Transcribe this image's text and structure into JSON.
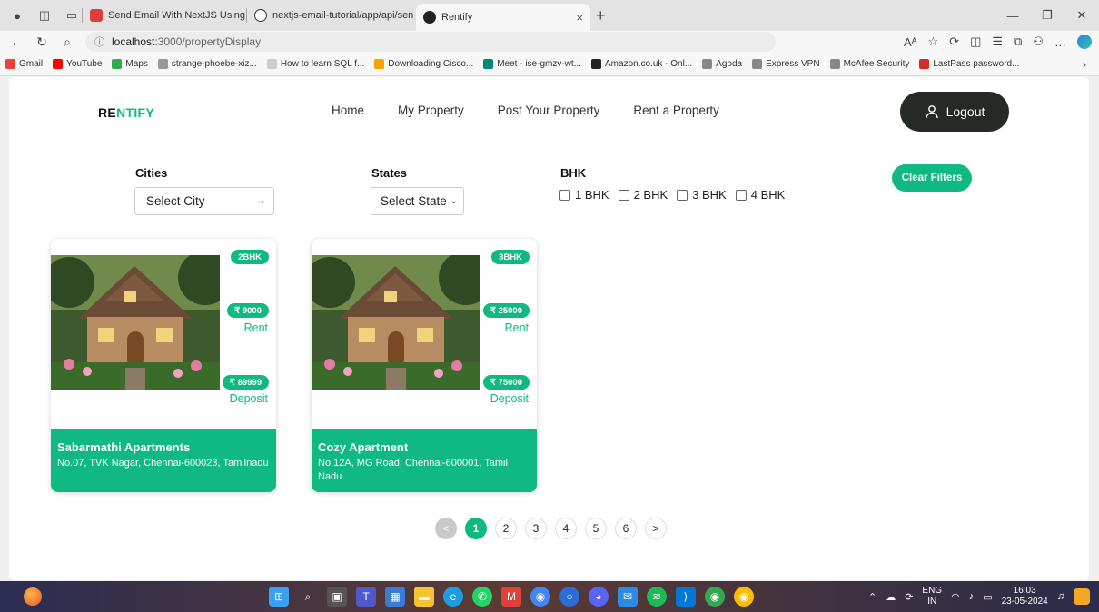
{
  "browser": {
    "tabs": [
      {
        "title": "Send Email With NextJS Using G",
        "color": "#e23b3b"
      },
      {
        "title": "nextjs-email-tutorial/app/api/sen",
        "color": "#333333"
      },
      {
        "title": "Rentify",
        "color": "#222222"
      }
    ],
    "url_host": "localhost",
    "url_path": ":3000/propertyDisplay",
    "bookmarks": [
      {
        "label": "Gmail",
        "color": "#ea4335"
      },
      {
        "label": "YouTube",
        "color": "#ff0000"
      },
      {
        "label": "Maps",
        "color": "#34a853"
      },
      {
        "label": "strange-phoebe-xiz...",
        "color": "#999999"
      },
      {
        "label": "How to learn SQL f...",
        "color": "#cccccc"
      },
      {
        "label": "Downloading Cisco...",
        "color": "#f4a300"
      },
      {
        "label": "Meet - ise-gmzv-wt...",
        "color": "#00897b"
      },
      {
        "label": "Amazon.co.uk - Onl...",
        "color": "#222222"
      },
      {
        "label": "Agoda",
        "color": "#888888"
      },
      {
        "label": "Express VPN",
        "color": "#888888"
      },
      {
        "label": "McAfee Security",
        "color": "#888888"
      },
      {
        "label": "LastPass password...",
        "color": "#d32d27"
      }
    ]
  },
  "header": {
    "logo_part1": "RE",
    "logo_part2": "NTIFY",
    "nav": [
      "Home",
      "My Property",
      "Post Your Property",
      "Rent a Property"
    ],
    "logout_label": "Logout"
  },
  "filters": {
    "cities_label": "Cities",
    "city_selected": "Select City",
    "states_label": "States",
    "state_selected": "Select State",
    "bhk_label": "BHK",
    "bhk_options": [
      "1 BHK",
      "2 BHK",
      "3 BHK",
      "4 BHK"
    ],
    "clear_label": "Clear Filters"
  },
  "properties": [
    {
      "bhk": "2BHK",
      "rent": "₹ 9000",
      "rent_label": "Rent",
      "deposit": "₹ 89999",
      "deposit_label": "Deposit",
      "name": "Sabarmathi Apartments",
      "address": "No.07, TVK Nagar, Chennai-600023, Tamilnadu"
    },
    {
      "bhk": "3BHK",
      "rent": "₹ 25000",
      "rent_label": "Rent",
      "deposit": "₹ 75000",
      "deposit_label": "Deposit",
      "name": "Cozy Apartment",
      "address": "No.12A, MG Road, Chennai-600001, Tamil Nadu"
    }
  ],
  "pagination": {
    "prev": "<",
    "pages": [
      "1",
      "2",
      "3",
      "4",
      "5",
      "6"
    ],
    "current": "1",
    "next": ">"
  },
  "taskbar": {
    "lang_top": "ENG",
    "lang_bottom": "IN",
    "time": "16:03",
    "date": "23-05-2024"
  },
  "theme": {
    "accent": "#10b981",
    "logout_bg": "#262a26"
  }
}
